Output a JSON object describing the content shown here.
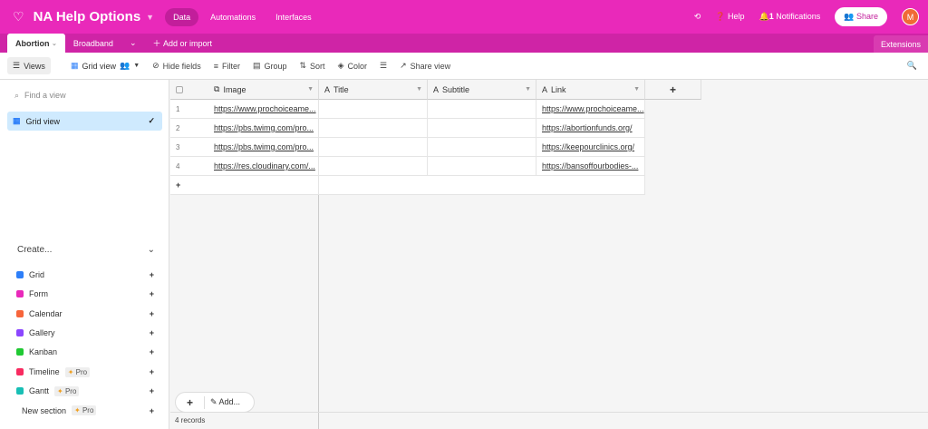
{
  "app": {
    "title": "NA Help Options",
    "nav": [
      "Data",
      "Automations",
      "Interfaces"
    ],
    "help": "Help",
    "notifications": "Notifications",
    "notif_count": "1",
    "share": "Share",
    "avatar": "M",
    "brand_color": "#e929ba"
  },
  "tabs": {
    "items": [
      "Abortion",
      "Broadband"
    ],
    "add": "Add or import",
    "extensions": "Extensions"
  },
  "toolbar": {
    "views": "Views",
    "grid_view": "Grid view",
    "hide_fields": "Hide fields",
    "filter": "Filter",
    "group": "Group",
    "sort": "Sort",
    "color": "Color",
    "share_view": "Share view"
  },
  "sidebar": {
    "find_placeholder": "Find a view",
    "active_view": "Grid view",
    "create": "Create...",
    "items": [
      {
        "label": "Grid",
        "color": "#2d7ff9"
      },
      {
        "label": "Form",
        "color": "#e929ba"
      },
      {
        "label": "Calendar",
        "color": "#f7653b"
      },
      {
        "label": "Gallery",
        "color": "#8b46ff"
      },
      {
        "label": "Kanban",
        "color": "#20c933"
      },
      {
        "label": "Timeline",
        "color": "#f82b60",
        "pro": "Pro"
      },
      {
        "label": "Gantt",
        "color": "#18bfb5",
        "pro": "Pro"
      },
      {
        "label": "New section",
        "pro": "Pro"
      }
    ]
  },
  "table": {
    "columns": [
      "Image",
      "Title",
      "Subtitle",
      "Link"
    ],
    "rows": [
      {
        "n": "1",
        "image": "https://www.prochoiceame...",
        "title": "",
        "subtitle": "",
        "link": "https://www.prochoiceame..."
      },
      {
        "n": "2",
        "image": "https://pbs.twimg.com/pro...",
        "title": "",
        "subtitle": "",
        "link": "https://abortionfunds.org/"
      },
      {
        "n": "3",
        "image": "https://pbs.twimg.com/pro...",
        "title": "",
        "subtitle": "",
        "link": "https://keepourclinics.org/"
      },
      {
        "n": "4",
        "image": "https://res.cloudinary.com/...",
        "title": "",
        "subtitle": "",
        "link": "https://bansoffourbodies-..."
      }
    ],
    "add_label": "Add...",
    "records": "4 records"
  }
}
